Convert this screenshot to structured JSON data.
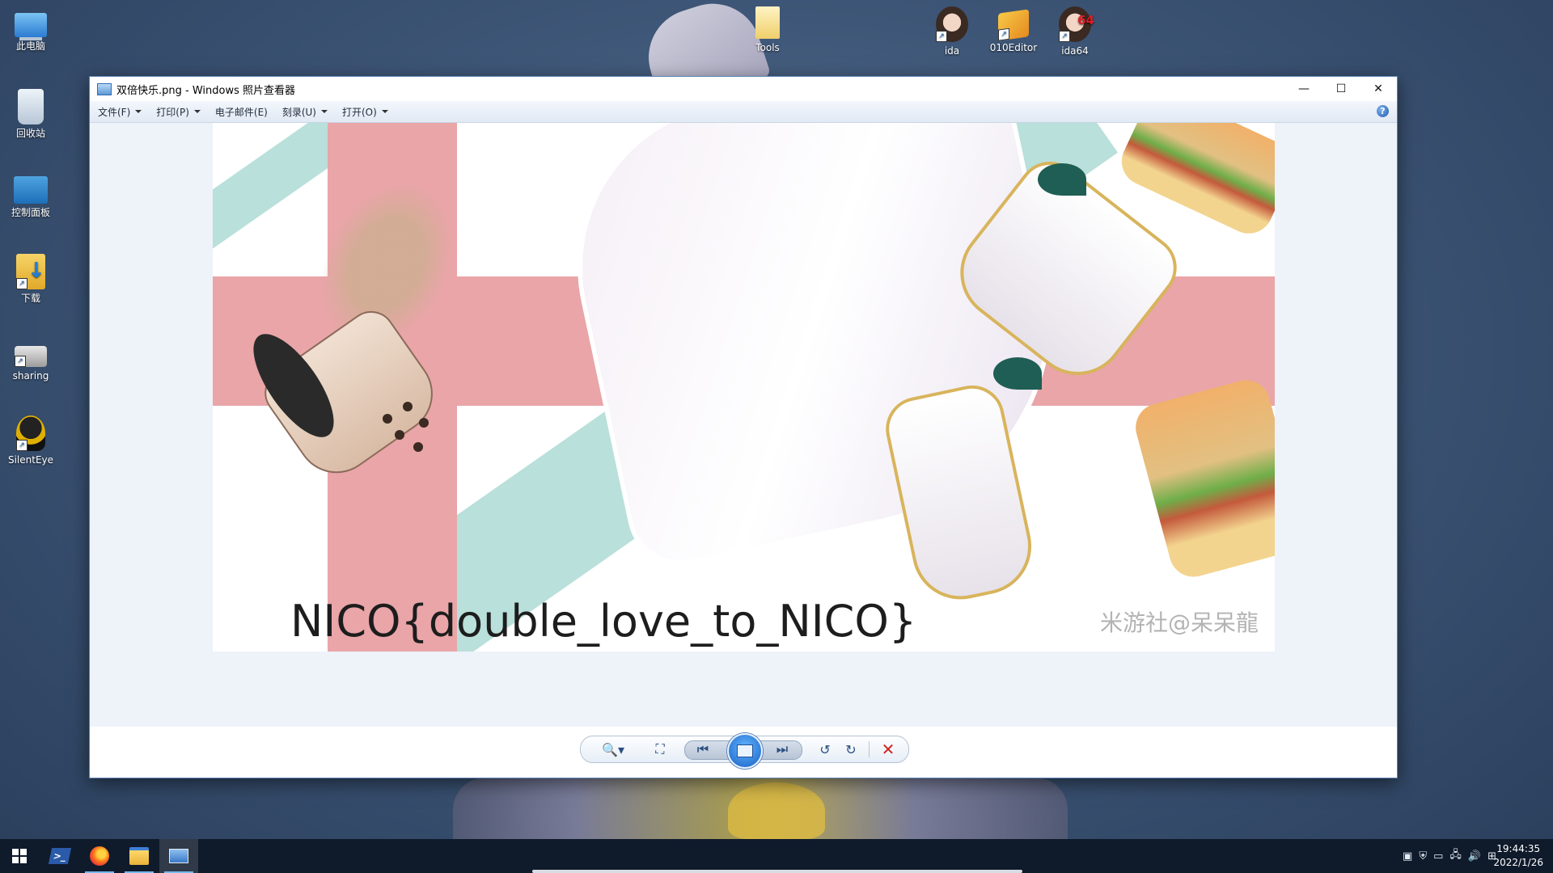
{
  "desktop": {
    "icons": [
      {
        "label": "此电脑"
      },
      {
        "label": "回收站"
      },
      {
        "label": "控制面板"
      },
      {
        "label": "下载"
      },
      {
        "label": "sharing"
      },
      {
        "label": "SilentEye"
      },
      {
        "label": "Tools"
      },
      {
        "label": "ida"
      },
      {
        "label": "010Editor"
      },
      {
        "label": "ida64"
      }
    ],
    "ida64_badge": "64"
  },
  "window": {
    "title": "双倍快乐.png - Windows 照片查看器",
    "controls": {
      "minimize": "—",
      "maximize": "☐",
      "close": "✕"
    },
    "menu": [
      {
        "label": "文件(F)",
        "has_dropdown": true
      },
      {
        "label": "打印(P)",
        "has_dropdown": true
      },
      {
        "label": "电子邮件(E)",
        "has_dropdown": false
      },
      {
        "label": "刻录(U)",
        "has_dropdown": true
      },
      {
        "label": "打开(O)",
        "has_dropdown": true
      }
    ],
    "help": "?",
    "image": {
      "flag_text": "NICO{double_love_to_NICO}",
      "watermark": "米游社@呆呆龍",
      "colors": {
        "teal": "#b9e0da",
        "pink": "#e9a5a8"
      }
    },
    "toolbar": {
      "zoom": "🔍▾",
      "actual_size": "⛶",
      "previous": "⏮",
      "next": "⏭",
      "rotate_ccw": "↺",
      "rotate_cw": "↻",
      "delete": "✕"
    }
  },
  "taskbar": {
    "time": "19:44:35",
    "date": "2022/1/26",
    "tray_icons": [
      "ime-icon",
      "security-icon",
      "battery-icon",
      "network-icon",
      "volume-icon",
      "input-method-icon"
    ]
  }
}
